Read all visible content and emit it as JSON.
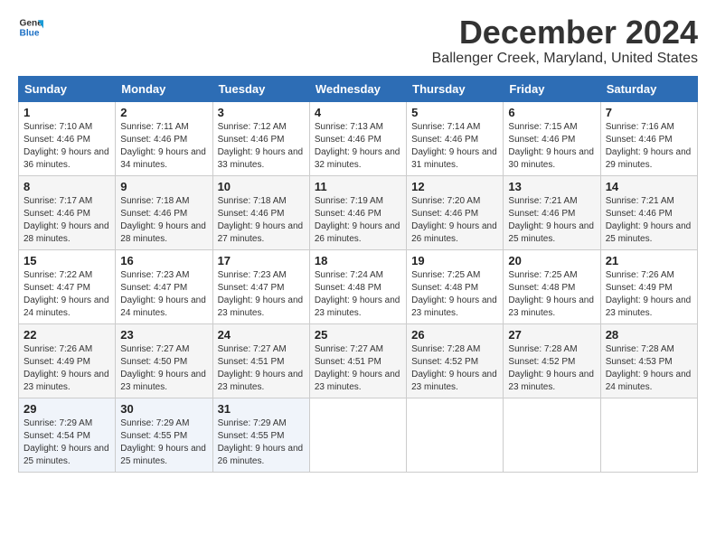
{
  "logo": {
    "line1": "General",
    "line2": "Blue",
    "icon_color": "#1a6fc4"
  },
  "title": "December 2024",
  "subtitle": "Ballenger Creek, Maryland, United States",
  "weekdays": [
    "Sunday",
    "Monday",
    "Tuesday",
    "Wednesday",
    "Thursday",
    "Friday",
    "Saturday"
  ],
  "weeks": [
    [
      {
        "day": "1",
        "sunrise": "Sunrise: 7:10 AM",
        "sunset": "Sunset: 4:46 PM",
        "daylight": "Daylight: 9 hours and 36 minutes."
      },
      {
        "day": "2",
        "sunrise": "Sunrise: 7:11 AM",
        "sunset": "Sunset: 4:46 PM",
        "daylight": "Daylight: 9 hours and 34 minutes."
      },
      {
        "day": "3",
        "sunrise": "Sunrise: 7:12 AM",
        "sunset": "Sunset: 4:46 PM",
        "daylight": "Daylight: 9 hours and 33 minutes."
      },
      {
        "day": "4",
        "sunrise": "Sunrise: 7:13 AM",
        "sunset": "Sunset: 4:46 PM",
        "daylight": "Daylight: 9 hours and 32 minutes."
      },
      {
        "day": "5",
        "sunrise": "Sunrise: 7:14 AM",
        "sunset": "Sunset: 4:46 PM",
        "daylight": "Daylight: 9 hours and 31 minutes."
      },
      {
        "day": "6",
        "sunrise": "Sunrise: 7:15 AM",
        "sunset": "Sunset: 4:46 PM",
        "daylight": "Daylight: 9 hours and 30 minutes."
      },
      {
        "day": "7",
        "sunrise": "Sunrise: 7:16 AM",
        "sunset": "Sunset: 4:46 PM",
        "daylight": "Daylight: 9 hours and 29 minutes."
      }
    ],
    [
      {
        "day": "8",
        "sunrise": "Sunrise: 7:17 AM",
        "sunset": "Sunset: 4:46 PM",
        "daylight": "Daylight: 9 hours and 28 minutes."
      },
      {
        "day": "9",
        "sunrise": "Sunrise: 7:18 AM",
        "sunset": "Sunset: 4:46 PM",
        "daylight": "Daylight: 9 hours and 28 minutes."
      },
      {
        "day": "10",
        "sunrise": "Sunrise: 7:18 AM",
        "sunset": "Sunset: 4:46 PM",
        "daylight": "Daylight: 9 hours and 27 minutes."
      },
      {
        "day": "11",
        "sunrise": "Sunrise: 7:19 AM",
        "sunset": "Sunset: 4:46 PM",
        "daylight": "Daylight: 9 hours and 26 minutes."
      },
      {
        "day": "12",
        "sunrise": "Sunrise: 7:20 AM",
        "sunset": "Sunset: 4:46 PM",
        "daylight": "Daylight: 9 hours and 26 minutes."
      },
      {
        "day": "13",
        "sunrise": "Sunrise: 7:21 AM",
        "sunset": "Sunset: 4:46 PM",
        "daylight": "Daylight: 9 hours and 25 minutes."
      },
      {
        "day": "14",
        "sunrise": "Sunrise: 7:21 AM",
        "sunset": "Sunset: 4:46 PM",
        "daylight": "Daylight: 9 hours and 25 minutes."
      }
    ],
    [
      {
        "day": "15",
        "sunrise": "Sunrise: 7:22 AM",
        "sunset": "Sunset: 4:47 PM",
        "daylight": "Daylight: 9 hours and 24 minutes."
      },
      {
        "day": "16",
        "sunrise": "Sunrise: 7:23 AM",
        "sunset": "Sunset: 4:47 PM",
        "daylight": "Daylight: 9 hours and 24 minutes."
      },
      {
        "day": "17",
        "sunrise": "Sunrise: 7:23 AM",
        "sunset": "Sunset: 4:47 PM",
        "daylight": "Daylight: 9 hours and 23 minutes."
      },
      {
        "day": "18",
        "sunrise": "Sunrise: 7:24 AM",
        "sunset": "Sunset: 4:48 PM",
        "daylight": "Daylight: 9 hours and 23 minutes."
      },
      {
        "day": "19",
        "sunrise": "Sunrise: 7:25 AM",
        "sunset": "Sunset: 4:48 PM",
        "daylight": "Daylight: 9 hours and 23 minutes."
      },
      {
        "day": "20",
        "sunrise": "Sunrise: 7:25 AM",
        "sunset": "Sunset: 4:48 PM",
        "daylight": "Daylight: 9 hours and 23 minutes."
      },
      {
        "day": "21",
        "sunrise": "Sunrise: 7:26 AM",
        "sunset": "Sunset: 4:49 PM",
        "daylight": "Daylight: 9 hours and 23 minutes."
      }
    ],
    [
      {
        "day": "22",
        "sunrise": "Sunrise: 7:26 AM",
        "sunset": "Sunset: 4:49 PM",
        "daylight": "Daylight: 9 hours and 23 minutes."
      },
      {
        "day": "23",
        "sunrise": "Sunrise: 7:27 AM",
        "sunset": "Sunset: 4:50 PM",
        "daylight": "Daylight: 9 hours and 23 minutes."
      },
      {
        "day": "24",
        "sunrise": "Sunrise: 7:27 AM",
        "sunset": "Sunset: 4:51 PM",
        "daylight": "Daylight: 9 hours and 23 minutes."
      },
      {
        "day": "25",
        "sunrise": "Sunrise: 7:27 AM",
        "sunset": "Sunset: 4:51 PM",
        "daylight": "Daylight: 9 hours and 23 minutes."
      },
      {
        "day": "26",
        "sunrise": "Sunrise: 7:28 AM",
        "sunset": "Sunset: 4:52 PM",
        "daylight": "Daylight: 9 hours and 23 minutes."
      },
      {
        "day": "27",
        "sunrise": "Sunrise: 7:28 AM",
        "sunset": "Sunset: 4:52 PM",
        "daylight": "Daylight: 9 hours and 23 minutes."
      },
      {
        "day": "28",
        "sunrise": "Sunrise: 7:28 AM",
        "sunset": "Sunset: 4:53 PM",
        "daylight": "Daylight: 9 hours and 24 minutes."
      }
    ],
    [
      {
        "day": "29",
        "sunrise": "Sunrise: 7:29 AM",
        "sunset": "Sunset: 4:54 PM",
        "daylight": "Daylight: 9 hours and 25 minutes."
      },
      {
        "day": "30",
        "sunrise": "Sunrise: 7:29 AM",
        "sunset": "Sunset: 4:55 PM",
        "daylight": "Daylight: 9 hours and 25 minutes."
      },
      {
        "day": "31",
        "sunrise": "Sunrise: 7:29 AM",
        "sunset": "Sunset: 4:55 PM",
        "daylight": "Daylight: 9 hours and 26 minutes."
      },
      null,
      null,
      null,
      null
    ]
  ]
}
